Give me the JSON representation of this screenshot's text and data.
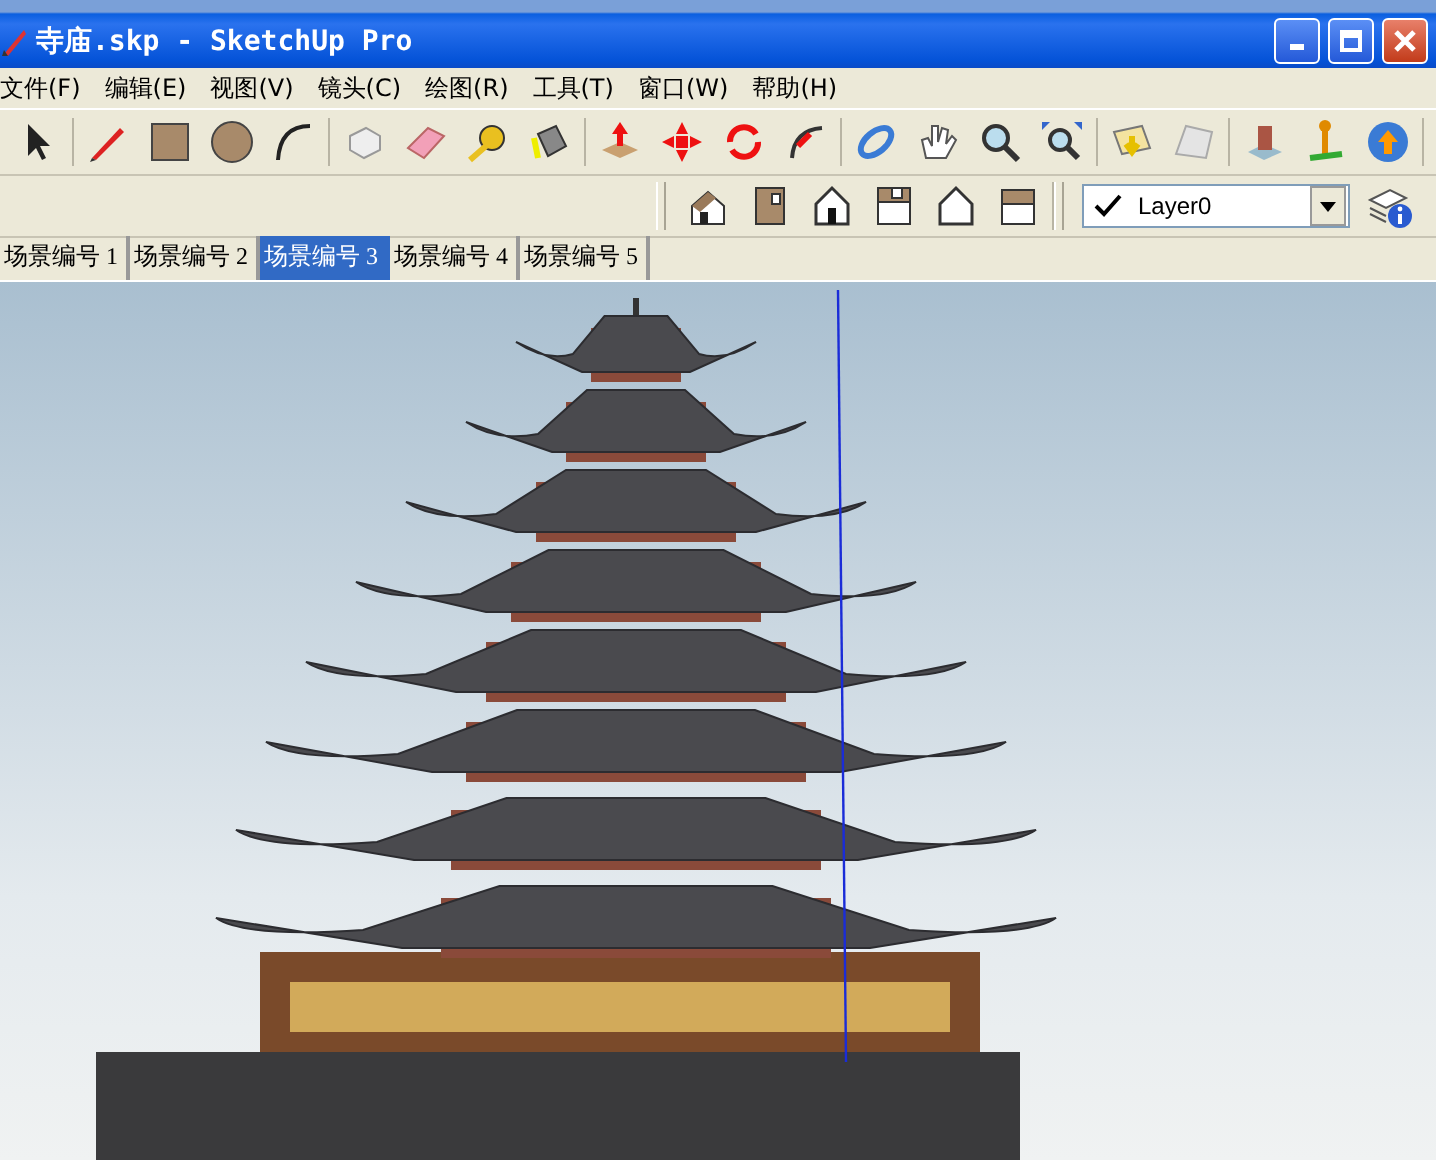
{
  "window": {
    "title": "寺庙.skp - SketchUp Pro"
  },
  "menu": [
    {
      "label": "文件(F)"
    },
    {
      "label": "编辑(E)"
    },
    {
      "label": "视图(V)"
    },
    {
      "label": "镜头(C)"
    },
    {
      "label": "绘图(R)"
    },
    {
      "label": "工具(T)"
    },
    {
      "label": "窗口(W)"
    },
    {
      "label": "帮助(H)"
    }
  ],
  "layer_dropdown": {
    "value": "Layer0"
  },
  "scene_tabs": [
    {
      "label": "场景编号 1",
      "selected": false
    },
    {
      "label": "场景编号 2",
      "selected": false
    },
    {
      "label": "场景编号 3",
      "selected": true
    },
    {
      "label": "场景编号 4",
      "selected": false
    },
    {
      "label": "场景编号 5",
      "selected": false
    }
  ]
}
